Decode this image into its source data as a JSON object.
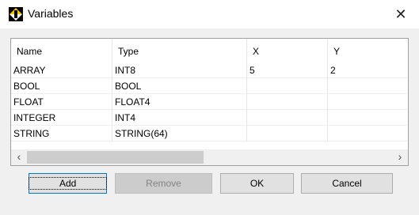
{
  "window": {
    "title": "Variables",
    "close_glyph": "✕"
  },
  "table": {
    "columns": [
      "Name",
      "Type",
      "X",
      "Y"
    ],
    "rows": [
      [
        "ARRAY",
        "INT8",
        "5",
        "2"
      ],
      [
        "BOOL",
        "BOOL",
        "",
        ""
      ],
      [
        "FLOAT",
        "FLOAT4",
        "",
        ""
      ],
      [
        "INTEGER",
        "INT4",
        "",
        ""
      ],
      [
        "STRING",
        "STRING(64)",
        "",
        ""
      ]
    ]
  },
  "scrollbar": {
    "left_glyph": "‹",
    "right_glyph": "›"
  },
  "buttons": {
    "add": "Add",
    "remove": "Remove",
    "ok": "OK",
    "cancel": "Cancel"
  },
  "colors": {
    "icon_bg": "#000000",
    "icon_fg": "#f5c400"
  }
}
